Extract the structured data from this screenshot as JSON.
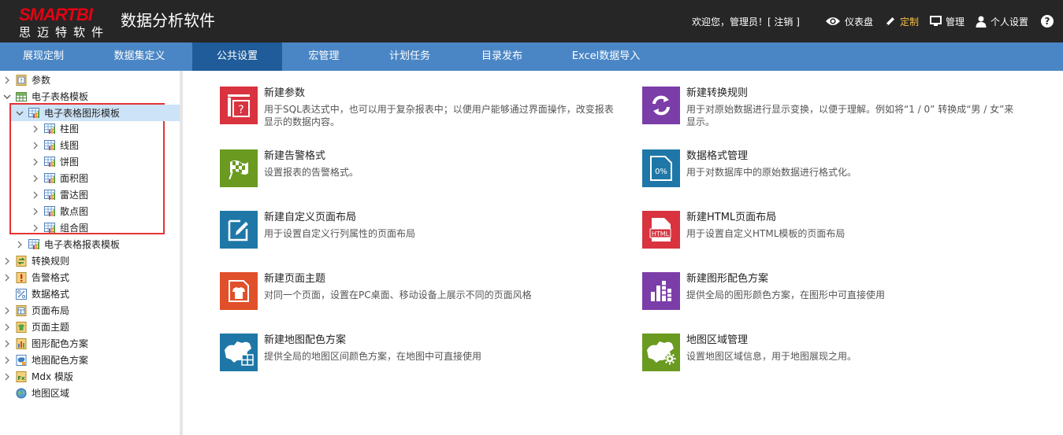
{
  "header": {
    "logo_top": "SMARTBI",
    "logo_bottom": "思迈特软件",
    "app_title": "数据分析软件",
    "welcome": "欢迎您，管理员！[ 注销 ]",
    "nav": [
      {
        "label": "仪表盘",
        "icon": "eye-icon"
      },
      {
        "label": "定制",
        "icon": "pencil-icon",
        "active": true
      },
      {
        "label": "管理",
        "icon": "monitor-icon"
      },
      {
        "label": "个人设置",
        "icon": "user-icon"
      }
    ],
    "help": "?"
  },
  "tabs": [
    {
      "label": "展现定制"
    },
    {
      "label": "数据集定义"
    },
    {
      "label": "公共设置",
      "active": true
    },
    {
      "label": "宏管理"
    },
    {
      "label": "计划任务"
    },
    {
      "label": "目录发布"
    },
    {
      "label": "Excel数据导入"
    }
  ],
  "tree": [
    {
      "label": "参数"
    },
    {
      "label": "电子表格模板"
    },
    {
      "label": "电子表格图形模板"
    },
    {
      "label": "柱图"
    },
    {
      "label": "线图"
    },
    {
      "label": "饼图"
    },
    {
      "label": "面积图"
    },
    {
      "label": "雷达图"
    },
    {
      "label": "散点图"
    },
    {
      "label": "组合图"
    },
    {
      "label": "电子表格报表模板"
    },
    {
      "label": "转换规则"
    },
    {
      "label": "告警格式"
    },
    {
      "label": "数据格式"
    },
    {
      "label": "页面布局"
    },
    {
      "label": "页面主题"
    },
    {
      "label": "图形配色方案"
    },
    {
      "label": "地图配色方案"
    },
    {
      "label": "Mdx 模版"
    },
    {
      "label": "地图区域"
    }
  ],
  "cards": [
    {
      "title": "新建参数",
      "desc1": "用于SQL表达式中，也可以用于复杂报表中；以便用户能够通过界面操作，改变报表",
      "desc2": "显示的数据内容。",
      "color": "#d9333f",
      "icon": "parameter-icon",
      "icon_text": "[?]"
    },
    {
      "title": "新建转换规则",
      "desc1": "用于对原始数据进行显示变换，以便于理解。例如将“1 / 0” 转换成“男 / 女”来",
      "desc2": "显示。",
      "color": "#7b3ea8",
      "icon": "refresh-icon"
    },
    {
      "title": "新建告警格式",
      "desc1": "设置报表的告警格式。",
      "desc2": "",
      "color": "#6a9a1f",
      "icon": "checkered-flag-icon"
    },
    {
      "title": "数据格式管理",
      "desc1": "用于对数据库中的原始数据进行格式化。",
      "desc2": "",
      "color": "#1f77a8",
      "icon": "percent-icon",
      "icon_text": "0%"
    },
    {
      "title": "新建自定义页面布局",
      "desc1": "用于设置自定义行列属性的页面布局",
      "desc2": "",
      "color": "#1f77a8",
      "icon": "edit-layout-icon"
    },
    {
      "title": "新建HTML页面布局",
      "desc1": "用于设置自定义HTML模板的页面布局",
      "desc2": "",
      "color": "#d9333f",
      "icon": "html-icon",
      "icon_text": "HTML"
    },
    {
      "title": "新建页面主题",
      "desc1": "对同一个页面，设置在PC桌面、移动设备上展示不同的页面风格",
      "desc2": "",
      "color": "#e0502a",
      "icon": "shirt-icon"
    },
    {
      "title": "新建图形配色方案",
      "desc1": "提供全局的图形颜色方案，在图形中可直接使用",
      "desc2": "",
      "color": "#7b3ea8",
      "icon": "bar-chart-icon"
    },
    {
      "title": "新建地图配色方案",
      "desc1": "提供全局的地图区间颜色方案，在地图中可直接使用",
      "desc2": "",
      "color": "#1f77a8",
      "icon": "map-color-icon"
    },
    {
      "title": "地图区域管理",
      "desc1": "设置地图区域信息，用于地图展现之用。",
      "desc2": "",
      "color": "#6a9a1f",
      "icon": "map-gear-icon"
    }
  ]
}
